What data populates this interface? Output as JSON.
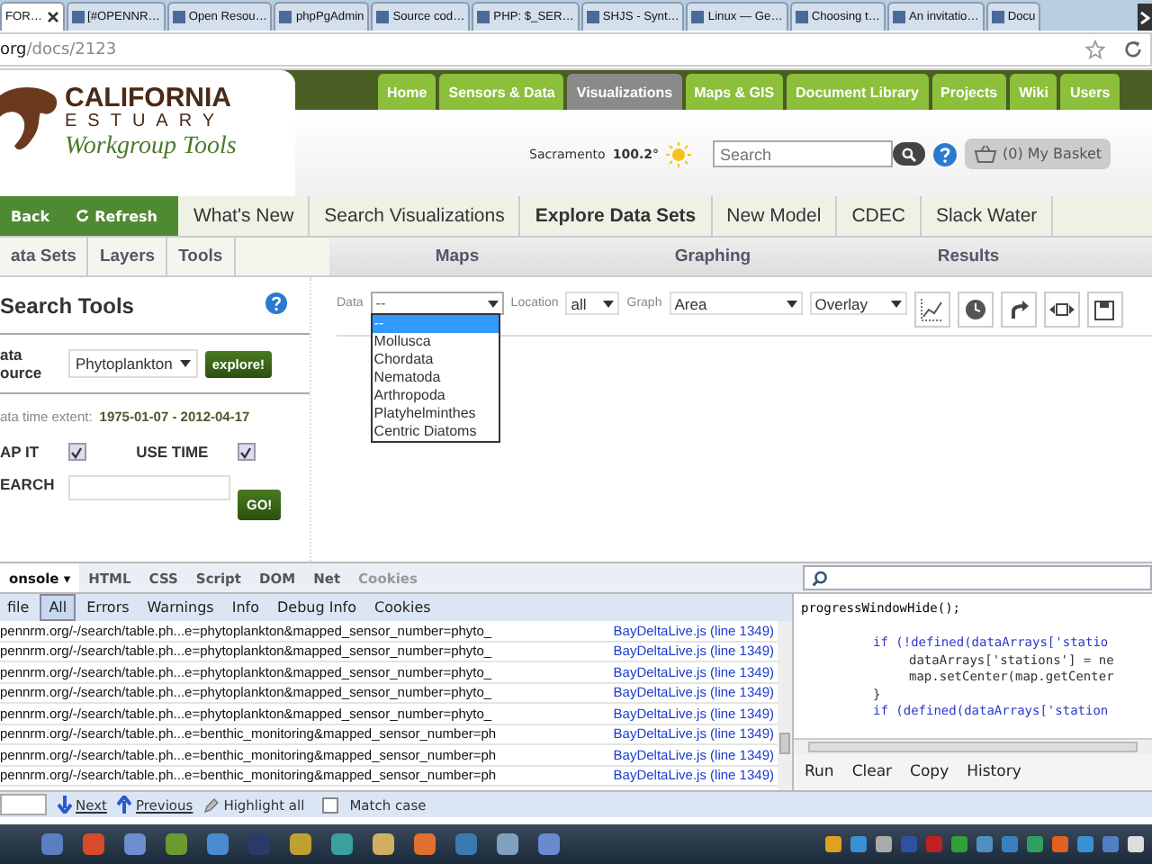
{
  "browser": {
    "tabs": [
      {
        "label": "FOR…",
        "selected": true
      },
      {
        "label": "[#OPENNR…",
        "selected": false
      },
      {
        "label": "Open Resou…",
        "selected": false
      },
      {
        "label": "phpPgAdmin",
        "selected": false
      },
      {
        "label": "Source cod…",
        "selected": false
      },
      {
        "label": "PHP: $_SER…",
        "selected": false
      },
      {
        "label": "SHJS - Synt…",
        "selected": false
      },
      {
        "label": "Linux — Ge…",
        "selected": false
      },
      {
        "label": "Choosing t…",
        "selected": false
      },
      {
        "label": "An invitatio…",
        "selected": false
      },
      {
        "label": "Docu",
        "selected": false
      }
    ],
    "address": {
      "host": "org",
      "path": "/docs/2123"
    }
  },
  "site": {
    "logo": {
      "line1": "CALIFORNIA",
      "line2": "ESTUARY",
      "line3": "Workgroup Tools"
    },
    "top_nav": [
      {
        "label": "Home",
        "selected": false
      },
      {
        "label": "Sensors & Data",
        "selected": false
      },
      {
        "label": "Visualizations",
        "selected": true
      },
      {
        "label": "Maps & GIS",
        "selected": false
      },
      {
        "label": "Document Library",
        "selected": false
      },
      {
        "label": "Projects",
        "selected": false
      },
      {
        "label": "Wiki",
        "selected": false
      },
      {
        "label": "Users",
        "selected": false
      }
    ],
    "weather": {
      "city": "Sacramento",
      "temperature": "100.2°"
    },
    "search": {
      "placeholder": "Search"
    },
    "basket": "(0) My Basket",
    "nav_actions": [
      "Back",
      "Refresh"
    ],
    "nav": [
      {
        "label": "What's New",
        "selected": false
      },
      {
        "label": "Search Visualizations",
        "selected": false
      },
      {
        "label": "Explore Data Sets",
        "selected": true
      },
      {
        "label": "New Model",
        "selected": false
      },
      {
        "label": "CDEC",
        "selected": false
      },
      {
        "label": "Slack Water",
        "selected": false
      }
    ],
    "left_tabs": [
      "ata Sets",
      "Layers",
      "Tools"
    ],
    "right_tabs": [
      "Maps",
      "Graphing",
      "Results"
    ],
    "search_tools": {
      "title": "Search Tools",
      "source_label": "ata ource",
      "source_value": "Phytoplankton",
      "explore": "explore!",
      "extent_label": "ata time extent:",
      "extent_value": "1975-01-07 - 2012-04-17",
      "map_it": {
        "label": "AP IT",
        "checked": true
      },
      "use_time": {
        "label": "USE TIME",
        "checked": true
      },
      "search_label": "EARCH",
      "go": "GO!"
    },
    "toolbar": {
      "data_label": "Data",
      "data_value": "--",
      "data_options": [
        {
          "label": "--",
          "selected": true
        },
        {
          "label": "Mollusca",
          "selected": false
        },
        {
          "label": "Chordata",
          "selected": false
        },
        {
          "label": "Nematoda",
          "selected": false
        },
        {
          "label": "Arthropoda",
          "selected": false
        },
        {
          "label": "Platyhelminthes",
          "selected": false
        },
        {
          "label": "Centric Diatoms",
          "selected": false
        }
      ],
      "location_label": "Location",
      "location_value": "all",
      "graph_label": "Graph",
      "graph_value": "Area",
      "mode_value": "Overlay"
    }
  },
  "firebug": {
    "tabs": [
      {
        "label": "onsole ▾",
        "selected": true,
        "disabled": false
      },
      {
        "label": "HTML",
        "selected": false,
        "disabled": false
      },
      {
        "label": "CSS",
        "selected": false,
        "disabled": false
      },
      {
        "label": "Script",
        "selected": false,
        "disabled": false
      },
      {
        "label": "DOM",
        "selected": false,
        "disabled": false
      },
      {
        "label": "Net",
        "selected": false,
        "disabled": false
      },
      {
        "label": "Cookies",
        "selected": false,
        "disabled": true
      }
    ],
    "filters": [
      {
        "label": "file",
        "selected": false
      },
      {
        "label": "All",
        "selected": true
      },
      {
        "label": "Errors",
        "selected": false
      },
      {
        "label": "Warnings",
        "selected": false
      },
      {
        "label": "Info",
        "selected": false
      },
      {
        "label": "Debug Info",
        "selected": false
      },
      {
        "label": "Cookies",
        "selected": false
      }
    ],
    "log": [
      {
        "url": "pennrm.org/-/search/table.ph...e=phytoplankton&mapped_sensor_number=phyto_",
        "source": "BayDeltaLive.js (line 1349)"
      },
      {
        "url": "pennrm.org/-/search/table.ph...e=phytoplankton&mapped_sensor_number=phyto_",
        "source": "BayDeltaLive.js (line 1349)"
      },
      {
        "url": "pennrm.org/-/search/table.ph...e=phytoplankton&mapped_sensor_number=phyto_",
        "source": "BayDeltaLive.js (line 1349)"
      },
      {
        "url": "pennrm.org/-/search/table.ph...e=phytoplankton&mapped_sensor_number=phyto_",
        "source": "BayDeltaLive.js (line 1349)"
      },
      {
        "url": "pennrm.org/-/search/table.ph...e=phytoplankton&mapped_sensor_number=phyto_",
        "source": "BayDeltaLive.js (line 1349)"
      },
      {
        "url": "pennrm.org/-/search/table.ph...e=benthic_monitoring&mapped_sensor_number=ph",
        "source": "BayDeltaLive.js (line 1349)"
      },
      {
        "url": "pennrm.org/-/search/table.ph...e=benthic_monitoring&mapped_sensor_number=ph",
        "source": "BayDeltaLive.js (line 1349)"
      },
      {
        "url": "pennrm.org/-/search/table.ph...e=benthic_monitoring&mapped_sensor_number=ph",
        "source": "BayDeltaLive.js (line 1349)"
      }
    ],
    "code": [
      {
        "text": "progressWindowHide();",
        "kind": "plain"
      },
      {
        "kind": "blank"
      },
      {
        "text": "if (!defined(dataArrays['statio",
        "kind": "indent1"
      },
      {
        "text": "dataArrays['stations'] = ne",
        "kind": "indent2"
      },
      {
        "text": "map.setCenter(map.getCenter",
        "kind": "indent2"
      },
      {
        "text": "}",
        "kind": "indent1"
      },
      {
        "text": "if (defined(dataArrays['station",
        "kind": "indent1"
      }
    ],
    "commands": [
      "Run",
      "Clear",
      "Copy",
      "History"
    ],
    "find": {
      "next": "Next",
      "previous": "Previous",
      "highlight": "Highlight all",
      "match_case": {
        "label": "Match case",
        "checked": false
      }
    }
  }
}
